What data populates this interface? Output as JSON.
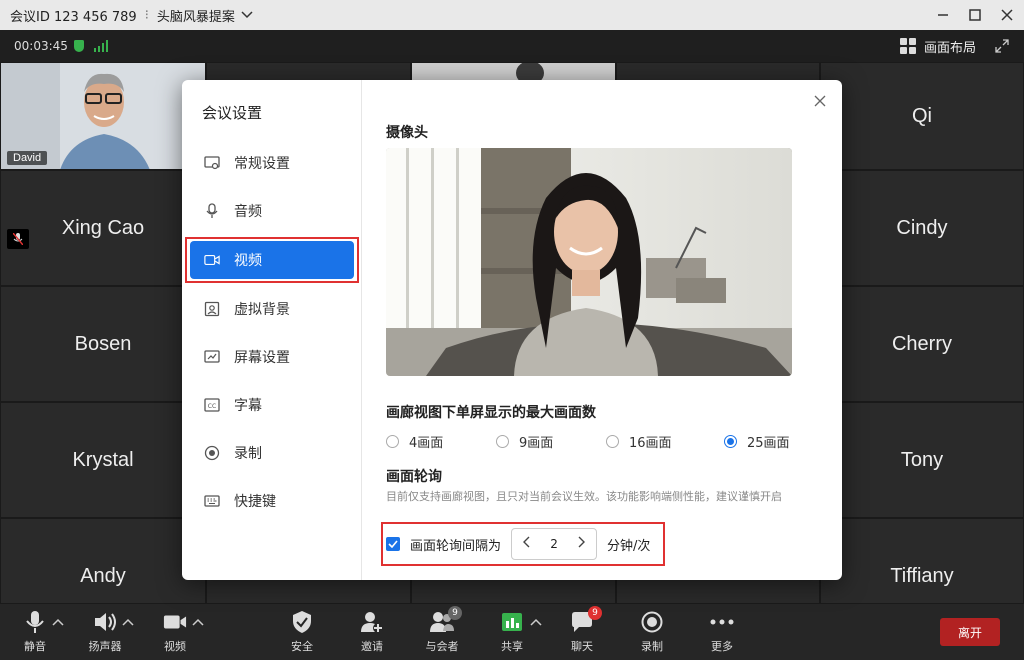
{
  "titlebar": {
    "meeting_id": "会议ID 123 456 789",
    "separator": "⁝",
    "meeting_topic": "头脑风暴提案"
  },
  "infobar": {
    "timer": "00:03:45",
    "layout_label": "画面布局"
  },
  "tiles": [
    {
      "name": "David",
      "type": "video"
    },
    {
      "name": "",
      "type": "video"
    },
    {
      "name": "Qi",
      "type": "name"
    },
    {
      "name": "Xing Cao",
      "type": "name"
    },
    {
      "name": "Cindy",
      "type": "name"
    },
    {
      "name": "Bosen",
      "type": "name"
    },
    {
      "name": "Cherry",
      "type": "name"
    },
    {
      "name": "Krystal",
      "type": "name"
    },
    {
      "name": "Tony",
      "type": "name"
    },
    {
      "name": "Andy",
      "type": "name"
    },
    {
      "name": "Tiffiany",
      "type": "name"
    }
  ],
  "toolbar": {
    "mute": "静音",
    "speaker": "扬声器",
    "video": "视频",
    "security": "安全",
    "invite": "邀请",
    "participants": "与会者",
    "participants_count": "9",
    "share": "共享",
    "chat": "聊天",
    "chat_count": "9",
    "record": "录制",
    "more": "更多",
    "leave": "离开"
  },
  "dialog": {
    "title": "会议设置",
    "nav": [
      {
        "label": "常规设置",
        "icon": "monitor-icon"
      },
      {
        "label": "音频",
        "icon": "microphone-icon"
      },
      {
        "label": "视频",
        "icon": "camera-icon"
      },
      {
        "label": "虚拟背景",
        "icon": "portrait-icon"
      },
      {
        "label": "屏幕设置",
        "icon": "screen-icon"
      },
      {
        "label": "字幕",
        "icon": "cc-icon"
      },
      {
        "label": "录制",
        "icon": "record-icon"
      },
      {
        "label": "快捷键",
        "icon": "keyboard-icon"
      }
    ],
    "active_nav": "视频",
    "camera_title": "摄像头",
    "gallery_title": "画廊视图下单屏显示的最大画面数",
    "gallery_options": [
      "4画面",
      "9画面",
      "16画面",
      "25画面"
    ],
    "gallery_selected": "25画面",
    "polling_title": "画面轮询",
    "polling_desc": "目前仅支持画廊视图，且只对当前会议生效。该功能影响端侧性能，建议谨慎开启",
    "polling_checkbox": "画面轮询间隔为",
    "polling_checked": true,
    "polling_value": "2",
    "polling_unit": "分钟/次"
  },
  "colors": {
    "accent": "#1a73e8",
    "highlight": "#e03131",
    "leave": "#b22222",
    "signal": "#37b24d"
  }
}
